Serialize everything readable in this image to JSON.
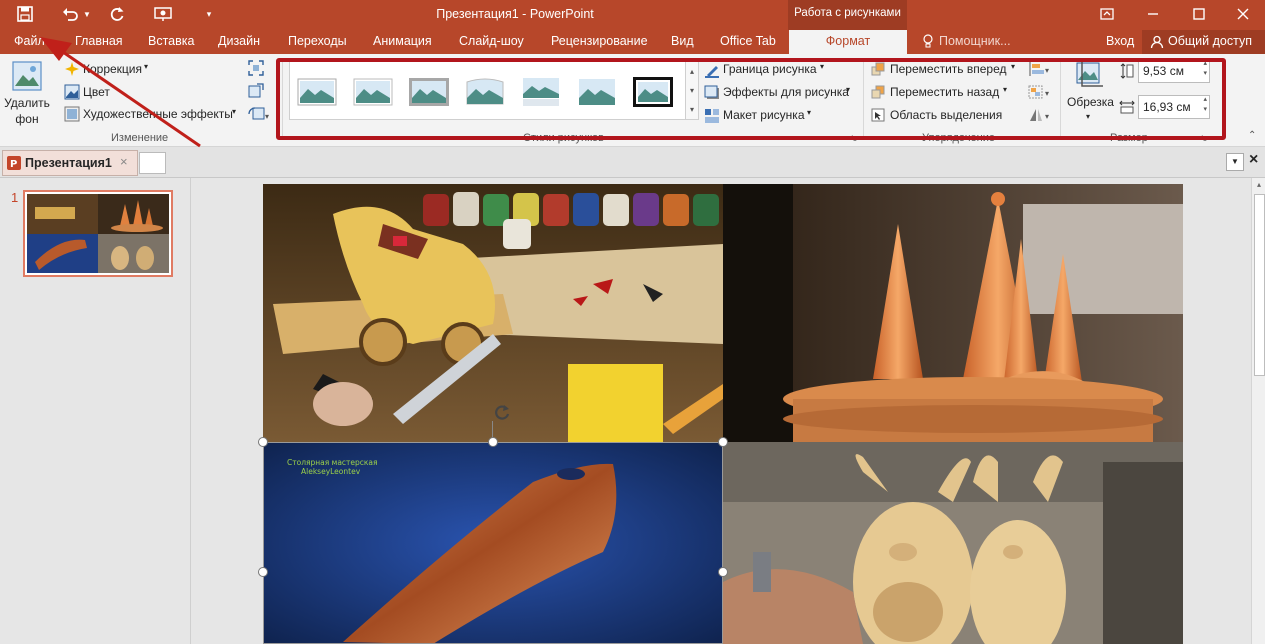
{
  "title_bar": {
    "document_title": "Презентация1 - PowerPoint",
    "context_tool": "Работа с рисунками"
  },
  "quick_access": {
    "icons": [
      "save-icon",
      "undo-icon",
      "redo-icon",
      "slideshow-icon",
      "customize-icon"
    ]
  },
  "tabs": {
    "file": "Файл",
    "home": "Главная",
    "insert": "Вставка",
    "design": "Дизайн",
    "transitions": "Переходы",
    "animations": "Анимация",
    "slideshow": "Слайд-шоу",
    "review": "Рецензирование",
    "view": "Вид",
    "officetab": "Office Tab",
    "format": "Формат",
    "tellme": "Помощник...",
    "signin": "Вход",
    "share": "Общий доступ"
  },
  "ribbon": {
    "remove_bg_line1": "Удалить",
    "remove_bg_line2": "фон",
    "corrections": "Коррекция",
    "color": "Цвет",
    "artistic": "Художественные эффекты",
    "group_adjust": "Изменение",
    "group_styles": "Стили рисунков",
    "border": "Граница рисунка",
    "effects": "Эффекты для рисунка",
    "layout": "Макет рисунка",
    "bring_forward": "Переместить вперед",
    "send_backward": "Переместить назад",
    "selection_pane": "Область выделения",
    "group_arrange": "Упорядочение",
    "crop": "Обрезка",
    "height": "9,53 см",
    "width": "16,93 см",
    "group_size": "Размер"
  },
  "doc_tabs": {
    "active": "Презентация1"
  },
  "slides_panel": {
    "slide_number": "1"
  },
  "slide": {
    "watermark_line1": "Столярная мастерская",
    "watermark_line2": "AlekseyLeontev"
  },
  "colors": {
    "accent": "#b7472a",
    "highlight_frame": "#b2151c",
    "arrow": "#c0201a"
  }
}
